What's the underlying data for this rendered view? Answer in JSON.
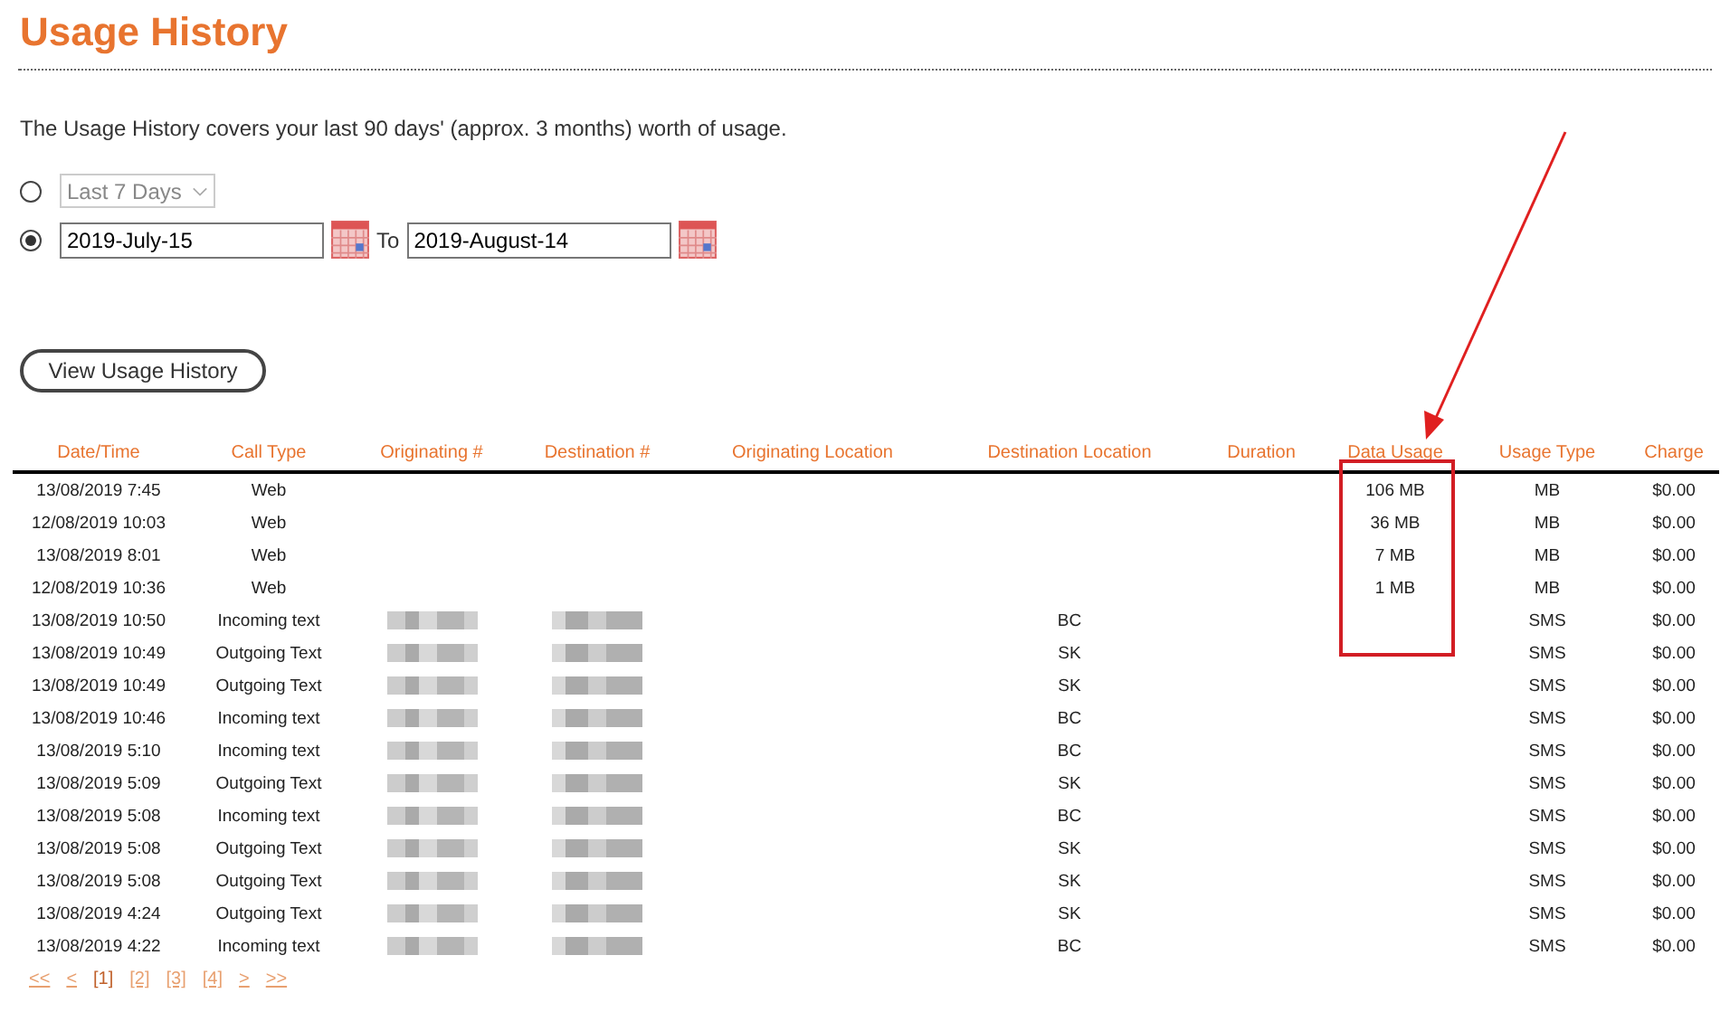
{
  "title": "Usage History",
  "intro": "The Usage History covers your last 90 days' (approx. 3 months) worth of usage.",
  "range_options": [
    {
      "kind": "preset",
      "selected": false,
      "value": "Last 7 Days",
      "disabled": true
    },
    {
      "kind": "dates",
      "selected": true,
      "from": "2019-July-15",
      "to_label": "To",
      "to": "2019-August-14"
    }
  ],
  "view_button": "View Usage History",
  "table": {
    "columns": [
      "Date/Time",
      "Call Type",
      "Originating #",
      "Destination #",
      "Originating Location",
      "Destination Location",
      "Duration",
      "Data Usage",
      "Usage Type",
      "Charge"
    ],
    "rows": [
      {
        "date_time": "13/08/2019 7:45",
        "call_type": "Web",
        "numbers_redacted": false,
        "data_usage": "106 MB",
        "usage_type": "MB",
        "charge": "$0.00"
      },
      {
        "date_time": "12/08/2019 10:03",
        "call_type": "Web",
        "numbers_redacted": false,
        "data_usage": "36 MB",
        "usage_type": "MB",
        "charge": "$0.00"
      },
      {
        "date_time": "13/08/2019 8:01",
        "call_type": "Web",
        "numbers_redacted": false,
        "data_usage": "7 MB",
        "usage_type": "MB",
        "charge": "$0.00"
      },
      {
        "date_time": "12/08/2019 10:36",
        "call_type": "Web",
        "numbers_redacted": false,
        "data_usage": "1 MB",
        "usage_type": "MB",
        "charge": "$0.00"
      },
      {
        "date_time": "13/08/2019 10:50",
        "call_type": "Incoming text",
        "numbers_redacted": true,
        "destination_location": "BC",
        "usage_type": "SMS",
        "charge": "$0.00"
      },
      {
        "date_time": "13/08/2019 10:49",
        "call_type": "Outgoing Text",
        "numbers_redacted": true,
        "destination_location": "SK",
        "usage_type": "SMS",
        "charge": "$0.00"
      },
      {
        "date_time": "13/08/2019 10:49",
        "call_type": "Outgoing Text",
        "numbers_redacted": true,
        "destination_location": "SK",
        "usage_type": "SMS",
        "charge": "$0.00"
      },
      {
        "date_time": "13/08/2019 10:46",
        "call_type": "Incoming text",
        "numbers_redacted": true,
        "destination_location": "BC",
        "usage_type": "SMS",
        "charge": "$0.00"
      },
      {
        "date_time": "13/08/2019 5:10",
        "call_type": "Incoming text",
        "numbers_redacted": true,
        "destination_location": "BC",
        "usage_type": "SMS",
        "charge": "$0.00"
      },
      {
        "date_time": "13/08/2019 5:09",
        "call_type": "Outgoing Text",
        "numbers_redacted": true,
        "destination_location": "SK",
        "usage_type": "SMS",
        "charge": "$0.00"
      },
      {
        "date_time": "13/08/2019 5:08",
        "call_type": "Incoming text",
        "numbers_redacted": true,
        "destination_location": "BC",
        "usage_type": "SMS",
        "charge": "$0.00"
      },
      {
        "date_time": "13/08/2019 5:08",
        "call_type": "Outgoing Text",
        "numbers_redacted": true,
        "destination_location": "SK",
        "usage_type": "SMS",
        "charge": "$0.00"
      },
      {
        "date_time": "13/08/2019 5:08",
        "call_type": "Outgoing Text",
        "numbers_redacted": true,
        "destination_location": "SK",
        "usage_type": "SMS",
        "charge": "$0.00"
      },
      {
        "date_time": "13/08/2019 4:24",
        "call_type": "Outgoing Text",
        "numbers_redacted": true,
        "destination_location": "SK",
        "usage_type": "SMS",
        "charge": "$0.00"
      },
      {
        "date_time": "13/08/2019 4:22",
        "call_type": "Incoming text",
        "numbers_redacted": true,
        "destination_location": "BC",
        "usage_type": "SMS",
        "charge": "$0.00"
      }
    ]
  },
  "pagination": [
    {
      "label": "<<",
      "selected": false
    },
    {
      "label": "<",
      "selected": false
    },
    {
      "label": "[1]",
      "selected": true
    },
    {
      "label": "[2]",
      "selected": false
    },
    {
      "label": "[3]",
      "selected": false
    },
    {
      "label": "[4]",
      "selected": false
    },
    {
      "label": ">",
      "selected": false
    },
    {
      "label": ">>",
      "selected": false
    }
  ]
}
